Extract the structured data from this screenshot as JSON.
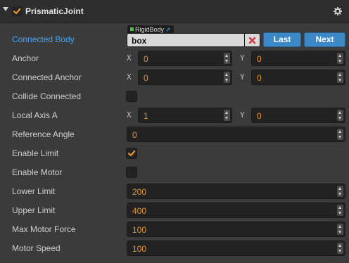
{
  "component": {
    "title": "PrismaticJoint",
    "enabled": true,
    "colors": {
      "accent": "#e69533",
      "link": "#3ea8ff",
      "button": "#3d88c6"
    }
  },
  "connected_body": {
    "label": "Connected Body",
    "type_tag": "RigidBody",
    "value": "box",
    "last_label": "Last",
    "next_label": "Next"
  },
  "anchor": {
    "label": "Anchor",
    "x_label": "X",
    "y_label": "Y",
    "x": "0",
    "y": "0"
  },
  "connected_anchor": {
    "label": "Connected Anchor",
    "x_label": "X",
    "y_label": "Y",
    "x": "0",
    "y": "0"
  },
  "collide_connected": {
    "label": "Collide Connected",
    "checked": false
  },
  "local_axis_a": {
    "label": "Local Axis A",
    "x_label": "X",
    "y_label": "Y",
    "x": "1",
    "y": "0"
  },
  "reference_angle": {
    "label": "Reference Angle",
    "value": "0"
  },
  "enable_limit": {
    "label": "Enable Limit",
    "checked": true
  },
  "enable_motor": {
    "label": "Enable Motor",
    "checked": false
  },
  "lower_limit": {
    "label": "Lower Limit",
    "value": "200"
  },
  "upper_limit": {
    "label": "Upper Limit",
    "value": "400"
  },
  "max_motor_force": {
    "label": "Max Motor Force",
    "value": "100"
  },
  "motor_speed": {
    "label": "Motor Speed",
    "value": "100"
  }
}
